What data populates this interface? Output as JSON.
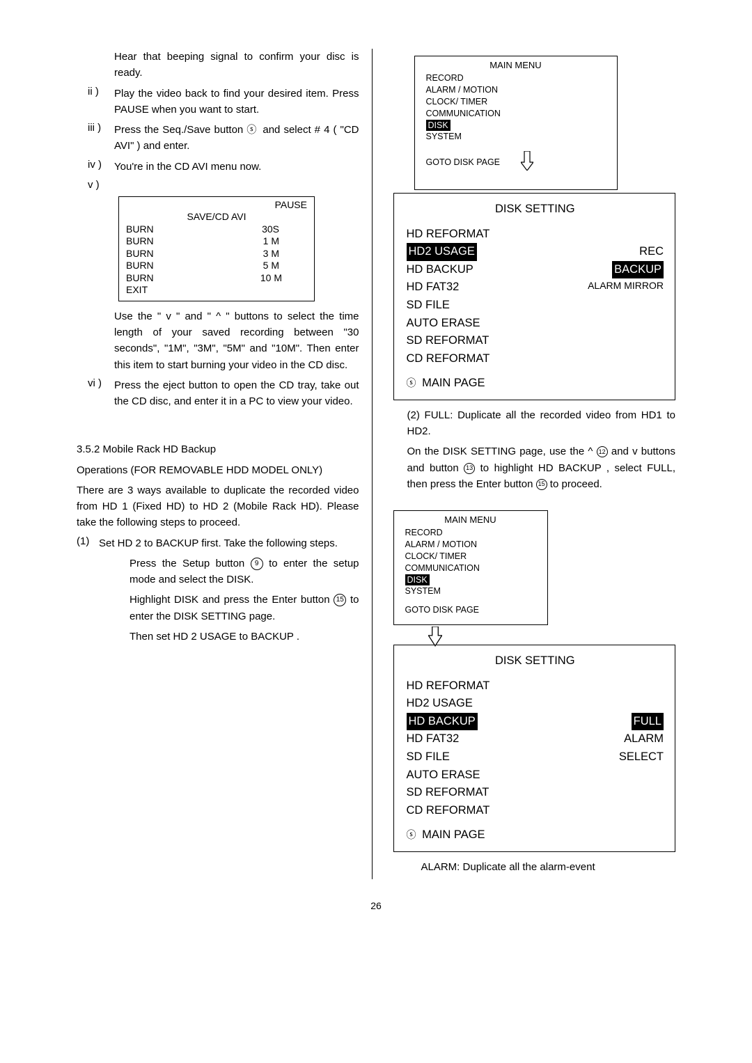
{
  "left": {
    "intro": "Hear that beeping signal to confirm your disc is ready.",
    "ii_num": "ii )",
    "ii": "Play the video back to find your desired item. Press PAUSE when you want to start.",
    "iii_num": "iii )",
    "iii": "Press the Seq./Save button ",
    "iii_after_icon": " and select # 4 ( \"CD AVI\" ) and enter.",
    "iv_num": "iv )",
    "iv": "You're in the CD AVI menu now.",
    "v_num": "v )",
    "box": {
      "pause": "PAUSE",
      "subtitle": "SAVE/CD AVI",
      "rows": [
        {
          "a": "BURN",
          "b": "30S"
        },
        {
          "a": "BURN",
          "b": "1 M"
        },
        {
          "a": "BURN",
          "b": "3 M"
        },
        {
          "a": "BURN",
          "b": "5 M"
        },
        {
          "a": "BURN",
          "b": "10 M"
        }
      ],
      "exit": "EXIT"
    },
    "v_body": "Use the \" v \" and \" ^ \" buttons to select the time length of your saved recording between \"30 seconds\", \"1M\", \"3M\", \"5M\" and \"10M\". Then enter this item to start burning your video in the CD disc.",
    "vi_num": "vi )",
    "vi": "Press the eject button to open the CD tray, take out the CD disc, and enter it in a PC to view your video.",
    "sec_heading": "3.5.2 Mobile Rack HD Backup",
    "sec_sub_a": "Operations  (FOR REMOVABLE HDD MODEL ONLY)",
    "sec_p1": "There are 3 ways available to duplicate the recorded video from HD 1 (Fixed HD) to HD 2 (Mobile Rack HD). Please take the following steps to proceed.",
    "step1_num": "(1)",
    "step1": "Set HD 2 to BACKUP first. Take the following steps.",
    "step1a_pre": "Press the Setup button ",
    "step1a_post": " to enter the setup mode and select the DISK.",
    "step1b_pre": "Highlight DISK and press the Enter button ",
    "step1b_post": " to enter the DISK SETTING page.",
    "step1c": "Then set HD 2 USAGE to BACKUP .",
    "icon_setup": "9",
    "icon_enter": "15"
  },
  "right": {
    "menu": {
      "title": "MAIN  MENU",
      "items": [
        "RECORD",
        "ALARM / MOTION",
        "CLOCK/ TIMER",
        "COMMUNICATION",
        "DISK",
        "SYSTEM"
      ],
      "goto": "GOTO DISK PAGE"
    },
    "disk1": {
      "title": "DISK SETTING",
      "rows": [
        {
          "l": "HD REFORMAT",
          "v": ""
        },
        {
          "l": "HD2 USAGE",
          "v": "REC",
          "inv": true
        },
        {
          "l": "HD BACKUP",
          "v": "BACKUP",
          "vinv": true
        },
        {
          "l": "HD FAT32",
          "v": "ALARM MIRROR"
        },
        {
          "l": "SD FILE",
          "v": ""
        },
        {
          "l": "AUTO ERASE",
          "v": ""
        },
        {
          "l": "SD REFORMAT",
          "v": ""
        },
        {
          "l": "CD REFORMAT",
          "v": ""
        }
      ],
      "footer": "MAIN PAGE"
    },
    "para2_a": "(2) FULL: Duplicate all the recorded video from HD1 to HD2.",
    "para2_b_pre": "On the DISK SETTING page, use the  ^ ",
    "para2_b_mid": " and  v   buttons and button ",
    "para2_b_post": " to highlight HD BACKUP , select FULL, then press the Enter button ",
    "para2_b_end": " to proceed.",
    "icon12": "12",
    "icon13": "13",
    "icon15": "15",
    "disk2": {
      "title": "DISK SETTING",
      "rows": [
        {
          "l": "HD REFORMAT",
          "v": ""
        },
        {
          "l": "HD2 USAGE",
          "v": ""
        },
        {
          "l": "HD BACKUP",
          "v": "FULL",
          "inv": true,
          "vinv": true
        },
        {
          "l": "HD FAT32",
          "v": "ALARM"
        },
        {
          "l": "SD FILE",
          "v": "SELECT"
        },
        {
          "l": "AUTO ERASE",
          "v": ""
        },
        {
          "l": "SD REFORMAT",
          "v": ""
        },
        {
          "l": "CD REFORMAT",
          "v": ""
        }
      ],
      "footer": "MAIN PAGE"
    },
    "alarm_tail": "ALARM: Duplicate all the alarm-event"
  },
  "pagenum": "26"
}
